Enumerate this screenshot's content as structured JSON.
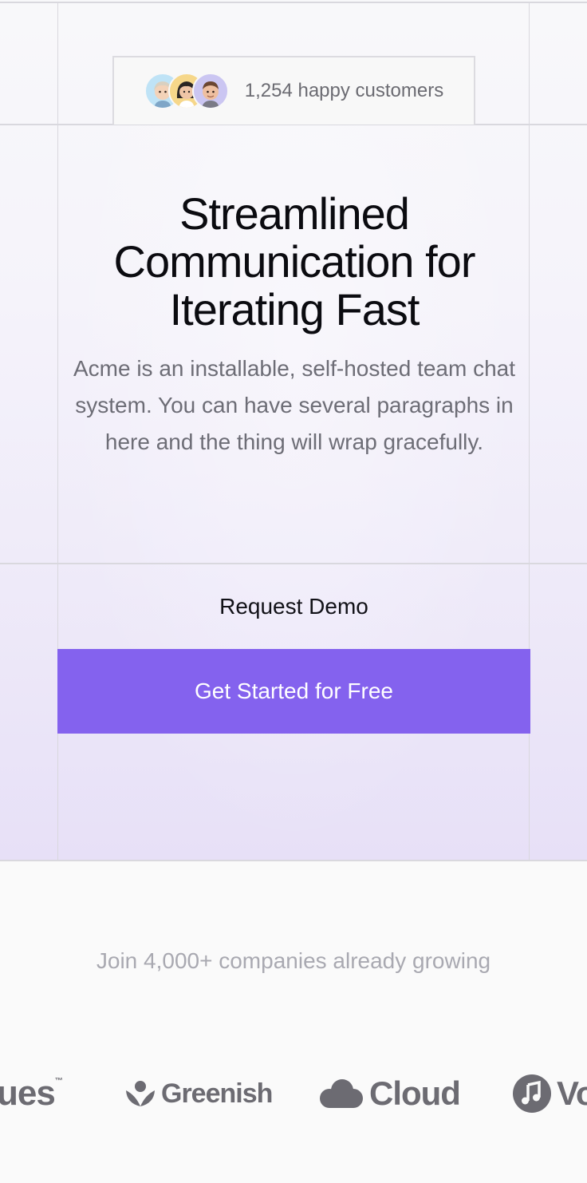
{
  "badge": {
    "text": "1,254 happy customers",
    "avatars": [
      "avatar-blonde",
      "avatar-dark-hair",
      "avatar-brown-hair"
    ]
  },
  "hero": {
    "headline_line1": "Streamlined",
    "headline_line2": "Communication for",
    "headline_line3": "Iterating Fast",
    "subtext": "Acme is an installable, self-hosted team chat system. You can have several paragraphs in here and the thing will wrap gracefully."
  },
  "actions": {
    "demo_label": "Request Demo",
    "cta_label": "Get Started for Free"
  },
  "social_proof": {
    "join_text": "Join 4,000+ companies already growing",
    "logos": [
      {
        "name": "ues",
        "icon": "trademark-wordmark"
      },
      {
        "name": "Greenish",
        "icon": "leaf-icon"
      },
      {
        "name": "Cloud",
        "icon": "cloud-icon"
      },
      {
        "name": "Vo",
        "icon": "music-note-icon"
      }
    ]
  },
  "colors": {
    "accent": "#8462ee",
    "heading": "#0b0b10",
    "muted": "#6d6d76",
    "logo": "#6c6b72"
  }
}
